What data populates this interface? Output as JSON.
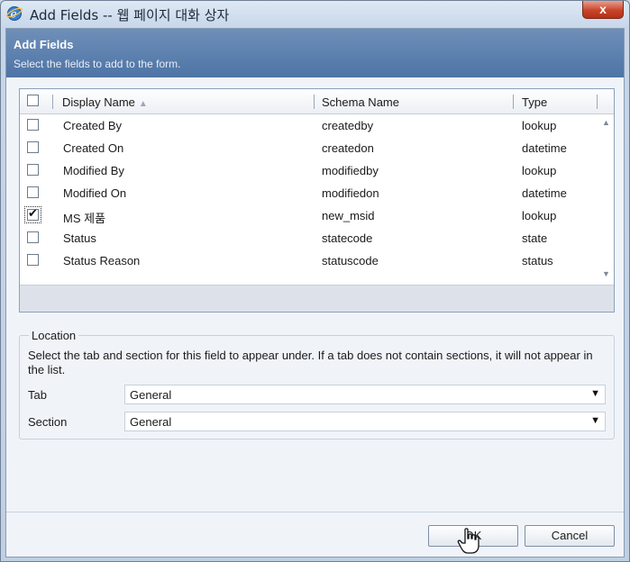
{
  "window": {
    "title": "Add Fields -- 웹 페이지 대화 상자",
    "close_label": "x"
  },
  "header": {
    "title": "Add Fields",
    "subtitle": "Select the fields to add to the form."
  },
  "grid": {
    "columns": {
      "display_name": "Display Name",
      "schema_name": "Schema Name",
      "type": "Type"
    },
    "rows": [
      {
        "display": "Created By",
        "schema": "createdby",
        "type": "lookup",
        "checked": false
      },
      {
        "display": "Created On",
        "schema": "createdon",
        "type": "datetime",
        "checked": false
      },
      {
        "display": "Modified By",
        "schema": "modifiedby",
        "type": "lookup",
        "checked": false
      },
      {
        "display": "Modified On",
        "schema": "modifiedon",
        "type": "datetime",
        "checked": false
      },
      {
        "display": "MS 제품",
        "schema": "new_msid",
        "type": "lookup",
        "checked": true
      },
      {
        "display": "Status",
        "schema": "statecode",
        "type": "state",
        "checked": false
      },
      {
        "display": "Status Reason",
        "schema": "statuscode",
        "type": "status",
        "checked": false
      }
    ]
  },
  "location": {
    "legend": "Location",
    "description": "Select the tab and section for this field to appear under. If a tab does not contain sections, it will not appear in the list.",
    "tab_label": "Tab",
    "tab_value": "General",
    "section_label": "Section",
    "section_value": "General"
  },
  "buttons": {
    "ok": "OK",
    "cancel": "Cancel"
  },
  "icons": {
    "app": "internet-explorer-icon",
    "cursor": "hand-pointer-icon"
  }
}
